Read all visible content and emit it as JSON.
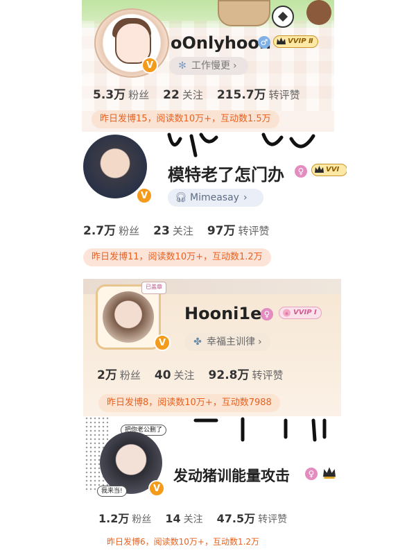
{
  "cards": [
    {
      "name": "oOnlyhoon",
      "vip": "VVIP Ⅱ",
      "pill": "工作慢更",
      "stats": [
        {
          "num": "5.3万",
          "label": "粉丝"
        },
        {
          "num": "22",
          "label": "关注"
        },
        {
          "num": "215.7万",
          "label": "转评赞"
        }
      ],
      "summary": "昨日发博15，阅读数10万+，互动数1.5万"
    },
    {
      "name": "模特老了怎门办",
      "vip": "VVI",
      "pill": "Mimeasay",
      "stats": [
        {
          "num": "2.7万",
          "label": "粉丝"
        },
        {
          "num": "23",
          "label": "关注"
        },
        {
          "num": "97万",
          "label": "转评赞"
        }
      ],
      "summary": "昨日发博11，阅读数10万+，互动数1.2万"
    },
    {
      "name": "Hooni1e",
      "vip": "VVIP Ⅰ",
      "pill": "幸福主训律",
      "stats": [
        {
          "num": "2万",
          "label": "粉丝"
        },
        {
          "num": "40",
          "label": "关注"
        },
        {
          "num": "92.8万",
          "label": "转评赞"
        }
      ],
      "summary": "昨日发博8，阅读数10万+，互动数7988",
      "frame_tag": "已盖章"
    },
    {
      "name": "发动猪训能量攻击",
      "stats": [
        {
          "num": "1.2万",
          "label": "粉丝"
        },
        {
          "num": "14",
          "label": "关注"
        },
        {
          "num": "47.5万",
          "label": "转评赞"
        }
      ],
      "summary": "昨日发博6，阅读数10万+，互动数1.2万",
      "bubble_top": "把你老公删了",
      "bubble_bottom": "我来当!"
    }
  ],
  "colors": {
    "summary_text": "#e8611f",
    "verified_badge": "#f59b1c",
    "male_badge": "#7fb0e6",
    "female_badge": "#e38cc0"
  },
  "icons": {
    "verified": "V",
    "male": "♂",
    "female": "♀"
  }
}
